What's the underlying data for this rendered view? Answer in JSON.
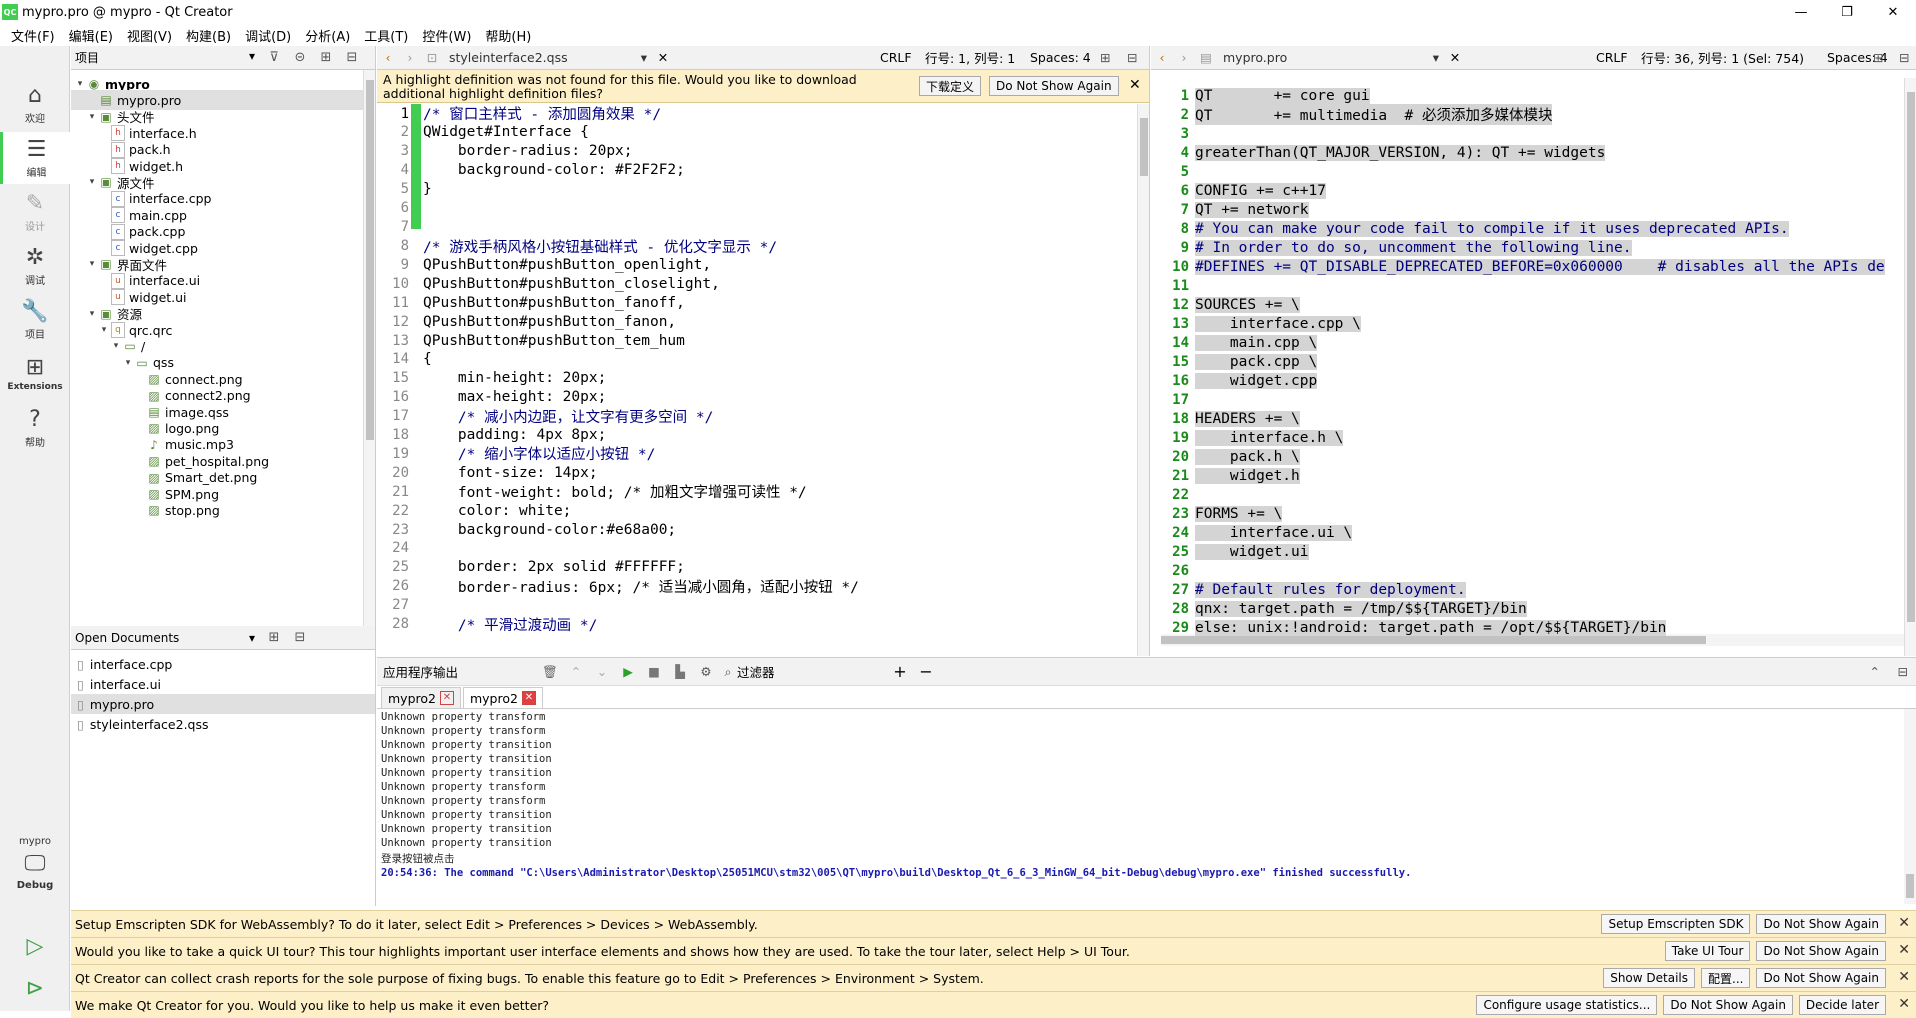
{
  "window": {
    "title": "mypro.pro @ mypro - Qt Creator",
    "min": "—",
    "max": "❐",
    "close": "✕"
  },
  "menu": [
    "文件(F)",
    "编辑(E)",
    "视图(V)",
    "构建(B)",
    "调试(D)",
    "分析(A)",
    "工具(T)",
    "控件(W)",
    "帮助(H)"
  ],
  "modes": [
    {
      "label": "欢迎",
      "icon": "⌂"
    },
    {
      "label": "编辑",
      "icon": "☰"
    },
    {
      "label": "设计",
      "icon": "✎"
    },
    {
      "label": "调试",
      "icon": "✲"
    },
    {
      "label": "项目",
      "icon": "🔧"
    },
    {
      "label": "Extensions",
      "icon": "⊞"
    },
    {
      "label": "帮助",
      "icon": "?"
    }
  ],
  "kit": {
    "project": "mypro",
    "mode": "Debug"
  },
  "project_panel": {
    "title": "项目",
    "tree": [
      {
        "label": "mypro",
        "level": 0,
        "arrow": "▾",
        "icon": "◉"
      },
      {
        "label": "mypro.pro",
        "level": 1,
        "arrow": "",
        "icon": "▤",
        "selected": true
      },
      {
        "label": "头文件",
        "level": 1,
        "arrow": "▾",
        "icon": "▣"
      },
      {
        "label": "interface.h",
        "level": 2,
        "arrow": "",
        "icon": "h"
      },
      {
        "label": "pack.h",
        "level": 2,
        "arrow": "",
        "icon": "h"
      },
      {
        "label": "widget.h",
        "level": 2,
        "arrow": "",
        "icon": "h"
      },
      {
        "label": "源文件",
        "level": 1,
        "arrow": "▾",
        "icon": "▣"
      },
      {
        "label": "interface.cpp",
        "level": 2,
        "arrow": "",
        "icon": "c"
      },
      {
        "label": "main.cpp",
        "level": 2,
        "arrow": "",
        "icon": "c"
      },
      {
        "label": "pack.cpp",
        "level": 2,
        "arrow": "",
        "icon": "c"
      },
      {
        "label": "widget.cpp",
        "level": 2,
        "arrow": "",
        "icon": "c"
      },
      {
        "label": "界面文件",
        "level": 1,
        "arrow": "▾",
        "icon": "▣"
      },
      {
        "label": "interface.ui",
        "level": 2,
        "arrow": "",
        "icon": "u"
      },
      {
        "label": "widget.ui",
        "level": 2,
        "arrow": "",
        "icon": "u"
      },
      {
        "label": "资源",
        "level": 1,
        "arrow": "▾",
        "icon": "▣"
      },
      {
        "label": "qrc.qrc",
        "level": 2,
        "arrow": "▾",
        "icon": "q"
      },
      {
        "label": "/",
        "level": 3,
        "arrow": "▾",
        "icon": "▭"
      },
      {
        "label": "qss",
        "level": 4,
        "arrow": "▾",
        "icon": "▭"
      },
      {
        "label": "connect.png",
        "level": 5,
        "arrow": "",
        "icon": "▨"
      },
      {
        "label": "connect2.png",
        "level": 5,
        "arrow": "",
        "icon": "▨"
      },
      {
        "label": "image.qss",
        "level": 5,
        "arrow": "",
        "icon": "▤"
      },
      {
        "label": "logo.png",
        "level": 5,
        "arrow": "",
        "icon": "▨"
      },
      {
        "label": "music.mp3",
        "level": 5,
        "arrow": "",
        "icon": "♪"
      },
      {
        "label": "pet_hospital.png",
        "level": 5,
        "arrow": "",
        "icon": "▨"
      },
      {
        "label": "Smart_det.png",
        "level": 5,
        "arrow": "",
        "icon": "▨"
      },
      {
        "label": "SPM.png",
        "level": 5,
        "arrow": "",
        "icon": "▨"
      },
      {
        "label": "stop.png",
        "level": 5,
        "arrow": "",
        "icon": "▨"
      }
    ]
  },
  "open_documents": {
    "title": "Open Documents",
    "items": [
      {
        "label": "interface.cpp",
        "selected": false
      },
      {
        "label": "interface.ui",
        "selected": false
      },
      {
        "label": "mypro.pro",
        "selected": true
      },
      {
        "label": "styleinterface2.qss",
        "selected": false
      }
    ]
  },
  "editor1": {
    "file": "styleinterface2.qss",
    "encoding": "CRLF",
    "position": "行号: 1, 列号: 1",
    "spaces": "Spaces: 4",
    "infobar": {
      "text": "A highlight definition was not found for this file. Would you like to download additional highlight definition files?",
      "download": "下载定义",
      "dismiss": "Do Not Show Again"
    },
    "lines": [
      {
        "n": "1",
        "t": "/* 窗口主样式 - 添加圆角效果 */",
        "c": "cmt"
      },
      {
        "n": "2",
        "t": "QWidget#Interface {"
      },
      {
        "n": "3",
        "t": "    border-radius: 20px;"
      },
      {
        "n": "4",
        "t": "    background-color: #F2F2F2;"
      },
      {
        "n": "5",
        "t": "}"
      },
      {
        "n": "6",
        "t": ""
      },
      {
        "n": "7",
        "t": ""
      },
      {
        "n": "8",
        "t": "/* 游戏手柄风格小按钮基础样式 - 优化文字显示 */",
        "c": "cmt"
      },
      {
        "n": "9",
        "t": "QPushButton#pushButton_openlight,"
      },
      {
        "n": "10",
        "t": "QPushButton#pushButton_closelight,"
      },
      {
        "n": "11",
        "t": "QPushButton#pushButton_fanoff,"
      },
      {
        "n": "12",
        "t": "QPushButton#pushButton_fanon,"
      },
      {
        "n": "13",
        "t": "QPushButton#pushButton_tem_hum"
      },
      {
        "n": "14",
        "t": "{"
      },
      {
        "n": "15",
        "t": "    min-height: 20px;"
      },
      {
        "n": "16",
        "t": "    max-height: 20px;"
      },
      {
        "n": "17",
        "t": "    /* 减小内边距，让文字有更多空间 */",
        "c": "cmt"
      },
      {
        "n": "18",
        "t": "    padding: 4px 8px;"
      },
      {
        "n": "19",
        "t": "    /* 缩小字体以适应小按钮 */",
        "c": "cmt"
      },
      {
        "n": "20",
        "t": "    font-size: 14px;"
      },
      {
        "n": "21",
        "t": "    font-weight: bold; /* 加粗文字增强可读性 */"
      },
      {
        "n": "22",
        "t": "    color: white;"
      },
      {
        "n": "23",
        "t": "    background-color:#e68a00;"
      },
      {
        "n": "24",
        "t": ""
      },
      {
        "n": "25",
        "t": "    border: 2px solid #FFFFFF;"
      },
      {
        "n": "26",
        "t": "    border-radius: 6px; /* 适当减小圆角，适配小按钮 */"
      },
      {
        "n": "27",
        "t": ""
      },
      {
        "n": "28",
        "t": "    /* 平滑过渡动画 */",
        "c": "cmt"
      }
    ]
  },
  "editor2": {
    "file": "mypro.pro",
    "encoding": "CRLF",
    "position": "行号: 36, 列号: 1 (Sel: 754)",
    "spaces": "Spaces: 4",
    "lines": [
      {
        "n": "1",
        "t": "QT       += core gui"
      },
      {
        "n": "2",
        "t": "QT       += multimedia  # 必须添加多媒体模块"
      },
      {
        "n": "3",
        "t": ""
      },
      {
        "n": "4",
        "t": "greaterThan(QT_MAJOR_VERSION, 4): QT += widgets"
      },
      {
        "n": "5",
        "t": ""
      },
      {
        "n": "6",
        "t": "CONFIG += c++17"
      },
      {
        "n": "7",
        "t": "QT += network"
      },
      {
        "n": "8",
        "t": "# You can make your code fail to compile if it uses deprecated APIs."
      },
      {
        "n": "9",
        "t": "# In order to do so, uncomment the following line."
      },
      {
        "n": "10",
        "t": "#DEFINES += QT_DISABLE_DEPRECATED_BEFORE=0x060000    # disables all the APIs de"
      },
      {
        "n": "11",
        "t": ""
      },
      {
        "n": "12",
        "t": "SOURCES += \\"
      },
      {
        "n": "13",
        "t": "    interface.cpp \\"
      },
      {
        "n": "14",
        "t": "    main.cpp \\"
      },
      {
        "n": "15",
        "t": "    pack.cpp \\"
      },
      {
        "n": "16",
        "t": "    widget.cpp"
      },
      {
        "n": "17",
        "t": ""
      },
      {
        "n": "18",
        "t": "HEADERS += \\"
      },
      {
        "n": "19",
        "t": "    interface.h \\"
      },
      {
        "n": "20",
        "t": "    pack.h \\"
      },
      {
        "n": "21",
        "t": "    widget.h"
      },
      {
        "n": "22",
        "t": ""
      },
      {
        "n": "23",
        "t": "FORMS += \\"
      },
      {
        "n": "24",
        "t": "    interface.ui \\"
      },
      {
        "n": "25",
        "t": "    widget.ui"
      },
      {
        "n": "26",
        "t": ""
      },
      {
        "n": "27",
        "t": "# Default rules for deployment."
      },
      {
        "n": "28",
        "t": "qnx: target.path = /tmp/$${TARGET}/bin"
      },
      {
        "n": "29",
        "t": "else: unix:!android: target.path = /opt/$${TARGET}/bin"
      }
    ]
  },
  "output": {
    "title": "应用程序输出",
    "filter": "过滤器",
    "tabs": [
      "mypro2",
      "mypro2"
    ],
    "lines": [
      "Unknown property transform",
      "Unknown property transform",
      "Unknown property transition",
      "Unknown property transition",
      "Unknown property transition",
      "Unknown property transform",
      "Unknown property transform",
      "Unknown property transition",
      "Unknown property transition",
      "Unknown property transition",
      "登录按钮被点击"
    ],
    "final": "20:54:36: The command \"C:\\Users\\Administrator\\Desktop\\25051MCU\\stm32\\005\\QT\\mypro\\build\\Desktop_Qt_6_6_3_MinGW_64_bit-Debug\\debug\\mypro.exe\" finished successfully."
  },
  "notifications": [
    {
      "text": "Setup Emscripten SDK for WebAssembly? To do it later, select Edit > Preferences > Devices > WebAssembly.",
      "buttons": [
        "Setup Emscripten SDK",
        "Do Not Show Again"
      ]
    },
    {
      "text": "Would you like to take a quick UI tour? This tour highlights important user interface elements and shows how they are used. To take the tour later, select Help > UI Tour.",
      "buttons": [
        "Take UI Tour",
        "Do Not Show Again"
      ]
    },
    {
      "text": "Qt Creator can collect crash reports for the sole purpose of fixing bugs. To enable this feature go to Edit > Preferences > Environment > System.",
      "buttons": [
        "Show Details",
        "配置...",
        "Do Not Show Again"
      ]
    },
    {
      "text": "We make Qt Creator for you. Would you like to help us make it even better?",
      "buttons": [
        "Configure usage statistics...",
        "Do Not Show Again",
        "Decide later"
      ]
    }
  ]
}
